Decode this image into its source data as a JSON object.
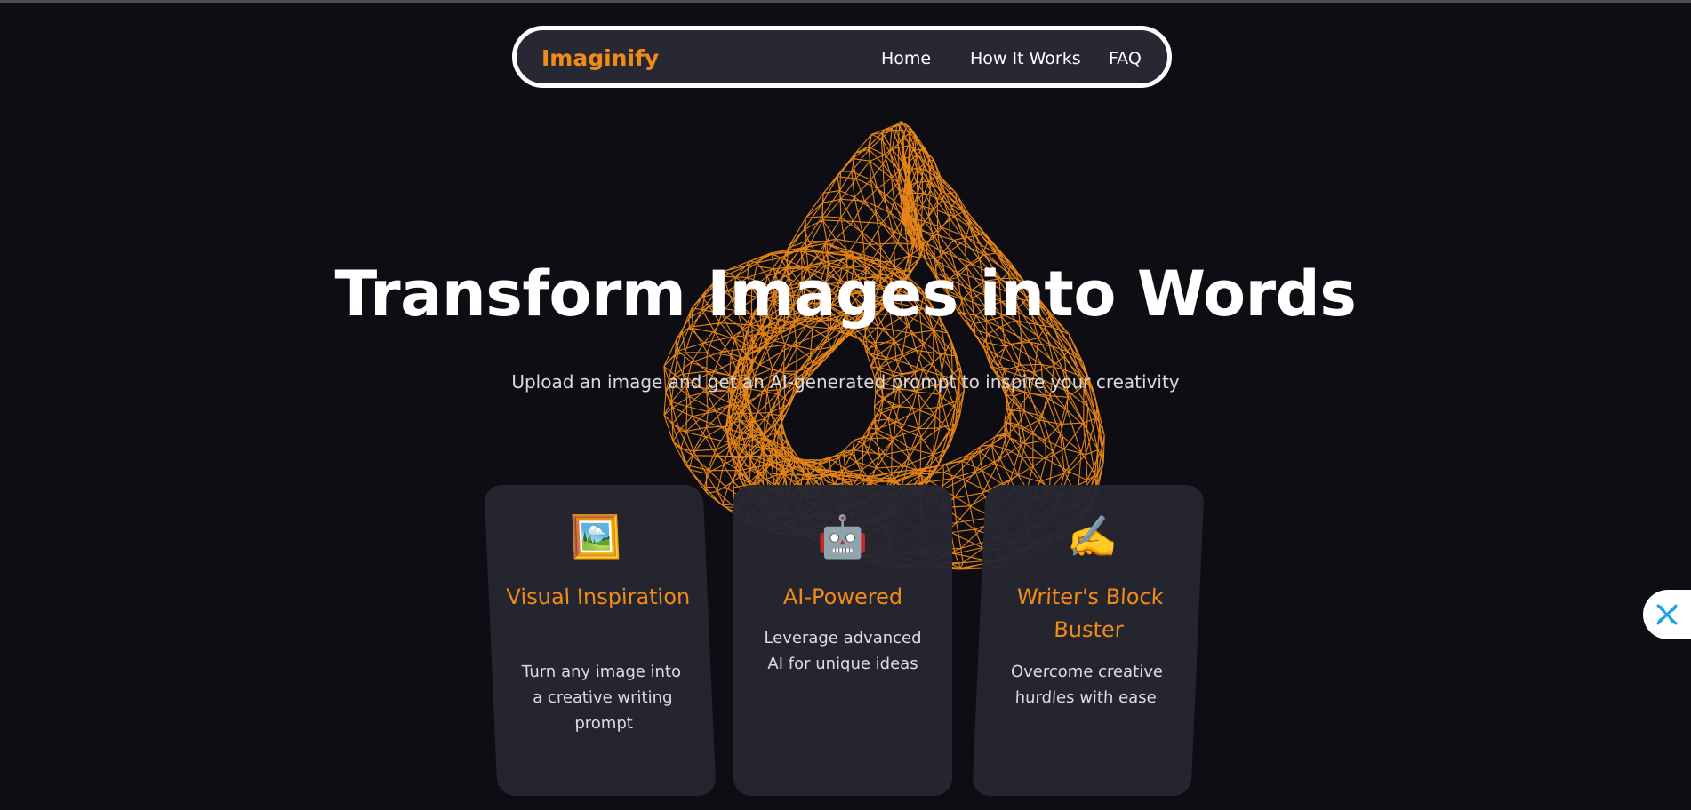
{
  "navbar": {
    "brand": "Imaginify",
    "links": [
      "Home",
      "How It Works",
      "FAQ"
    ]
  },
  "hero": {
    "title": "Transform Images into Words",
    "subtitle": "Upload an image and get an AI-generated prompt to inspire your creativity"
  },
  "features": [
    {
      "emoji": "🖼️",
      "icon": "framed-picture-icon",
      "title": "Visual Inspiration",
      "description": "Turn any image into a creative writing prompt"
    },
    {
      "emoji": "🤖",
      "icon": "robot-icon",
      "title": "AI-Powered",
      "description": "Leverage advanced AI for unique ideas"
    },
    {
      "emoji": "✍️",
      "icon": "writing-hand-icon",
      "title": "Writer's Block Buster",
      "description": "Overcome creative hurdles with ease"
    }
  ],
  "colors": {
    "background": "#0e0d14",
    "accent": "#f18b17",
    "card": "#262632",
    "nav": "#272834",
    "widget_icon": "#1ba3e8"
  },
  "side_widget": {
    "icon": "pinwheel-icon"
  }
}
